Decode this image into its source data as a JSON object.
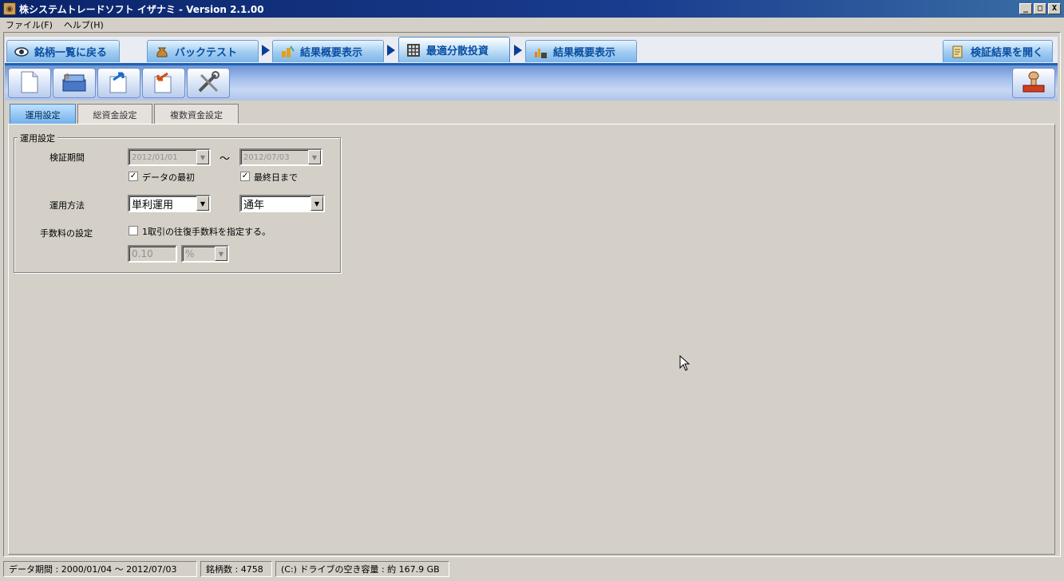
{
  "window": {
    "title": "株システムトレードソフト イザナミ - Version 2.1.00",
    "minimize": "_",
    "maximize": "□",
    "close": "X"
  },
  "menu": [
    "ファイル(F)",
    "ヘルプ(H)"
  ],
  "nav": {
    "back": "銘柄一覧に戻る",
    "backtest": "バックテスト",
    "summary1": "結果概要表示",
    "optimize": "最適分散投資",
    "summary2": "結果概要表示",
    "open_results": "検証結果を開く"
  },
  "toolbar_icons": [
    "new-document-icon",
    "money-box-icon",
    "export-icon",
    "import-icon",
    "tools-icon",
    "stamp-icon"
  ],
  "subtabs": [
    "運用設定",
    "総資金設定",
    "複数資金設定"
  ],
  "settings": {
    "group_title": "運用設定",
    "period_label": "検証期間",
    "start_date": "2012/01/01",
    "tilde": "～",
    "end_date": "2012/07/03",
    "check_first": "データの最初",
    "check_last": "最終日まで",
    "method_label": "運用方法",
    "method_value": "単利運用",
    "period_value": "通年",
    "fee_label": "手数料の設定",
    "fee_check": "1取引の往復手数料を指定する。",
    "fee_value": "0.10",
    "fee_unit": "%"
  },
  "status": {
    "data_period": "データ期間 : 2000/01/04 ～ 2012/07/03",
    "stock_count": "銘柄数 : 4758",
    "disk_space": "(C:) ドライブの空き容量 : 約 167.9 GB"
  }
}
